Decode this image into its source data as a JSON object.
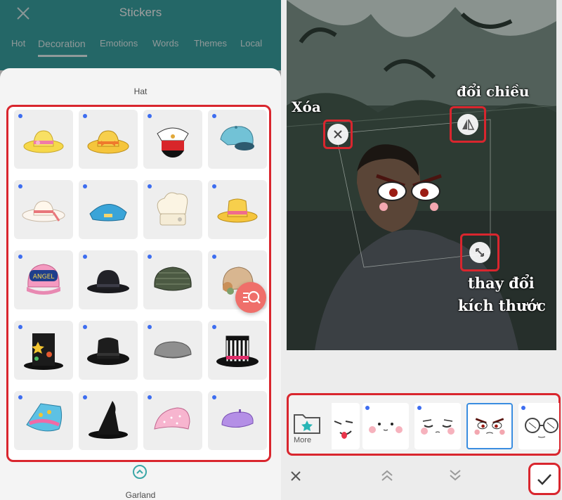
{
  "left": {
    "title": "Stickers",
    "tabs": [
      "Hot",
      "Decoration",
      "Emotions",
      "Words",
      "Themes",
      "Local"
    ],
    "active_tab": "Decoration",
    "section_hat": "Hat",
    "section_next": "Garland",
    "hats": [
      "yellow-sun-hat",
      "yellow-bow-hat",
      "captain-hat",
      "blue-cap",
      "white-sun-hat",
      "blue-flight-cap",
      "chef-hat",
      "yellow-fedora",
      "angel-trucker-cap",
      "black-bowler-hat",
      "green-flat-cap",
      "cloche-hat",
      "star-top-hat",
      "black-fedora",
      "grey-flat-cap",
      "striped-top-hat",
      "fish-hat",
      "witch-hat",
      "pink-beanie",
      "purple-beret"
    ],
    "cap_text": "ANGEL"
  },
  "right": {
    "labels": {
      "delete": "Xóa",
      "flip": "đổi chiều",
      "resize_line1": "thay đổi",
      "resize_line2": "kích thước"
    },
    "more_label": "More",
    "stickers": [
      "tongue-face",
      "blush-face",
      "sleepy-face",
      "angry-face",
      "glasses-face"
    ],
    "selected_sticker": "angry-face",
    "colors": {
      "accent": "#3aa7a7",
      "highlight": "#d9262e",
      "selection": "#3a8de0",
      "dot": "#3d6df0"
    }
  }
}
